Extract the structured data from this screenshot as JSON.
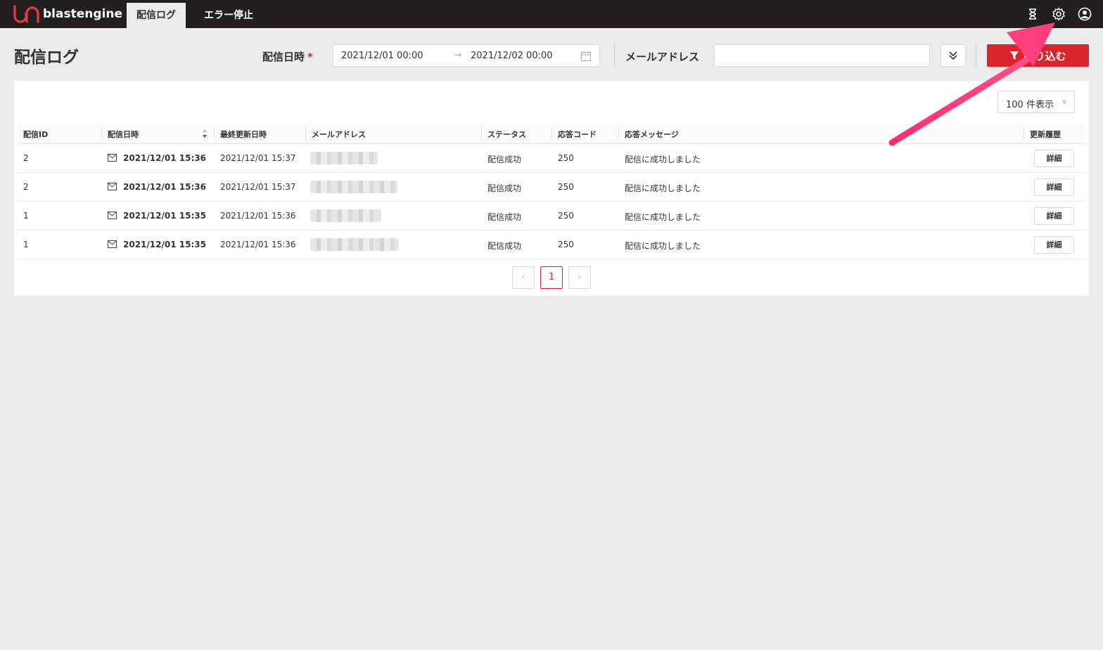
{
  "brand": {
    "name": "blastengine"
  },
  "nav": {
    "tabs": [
      {
        "label": "配信ログ",
        "active": true
      },
      {
        "label": "エラー停止",
        "active": false
      }
    ]
  },
  "topbar_icons": [
    "hourglass-icon",
    "gear-icon",
    "user-icon"
  ],
  "page": {
    "title": "配信ログ"
  },
  "filters": {
    "date_label": "配信日時",
    "required_mark": "*",
    "date_from": "2021/12/01 00:00",
    "date_to": "2021/12/02 00:00",
    "date_sep": "→",
    "email_label": "メールアドレス",
    "email_value": "",
    "submit_label": "絞り込む"
  },
  "table": {
    "page_size": "100 件表示",
    "columns": [
      "配信ID",
      "配信日時",
      "最終更新日時",
      "メールアドレス",
      "ステータス",
      "応答コード",
      "応答メッセージ",
      "更新履歴"
    ],
    "rows": [
      {
        "id": "2",
        "sent_at": "2021/12/01 15:36",
        "updated_at": "2021/12/01 15:37",
        "email": "(blurred)",
        "status": "配信成功",
        "code": "250",
        "message": "配信に成功しました",
        "action": "詳細"
      },
      {
        "id": "2",
        "sent_at": "2021/12/01 15:36",
        "updated_at": "2021/12/01 15:37",
        "email": "(blurred)",
        "status": "配信成功",
        "code": "250",
        "message": "配信に成功しました",
        "action": "詳細"
      },
      {
        "id": "1",
        "sent_at": "2021/12/01 15:35",
        "updated_at": "2021/12/01 15:36",
        "email": "(blurred)",
        "status": "配信成功",
        "code": "250",
        "message": "配信に成功しました",
        "action": "詳細"
      },
      {
        "id": "1",
        "sent_at": "2021/12/01 15:35",
        "updated_at": "2021/12/01 15:36",
        "email": "(blurred)",
        "status": "配信成功",
        "code": "250",
        "message": "配信に成功しました",
        "action": "詳細"
      }
    ]
  },
  "pagination": {
    "prev": "‹",
    "current": "1",
    "next": "›"
  },
  "colors": {
    "accent": "#d9262d",
    "topbar": "#231f1f",
    "annotation": "#ff3e7f"
  }
}
